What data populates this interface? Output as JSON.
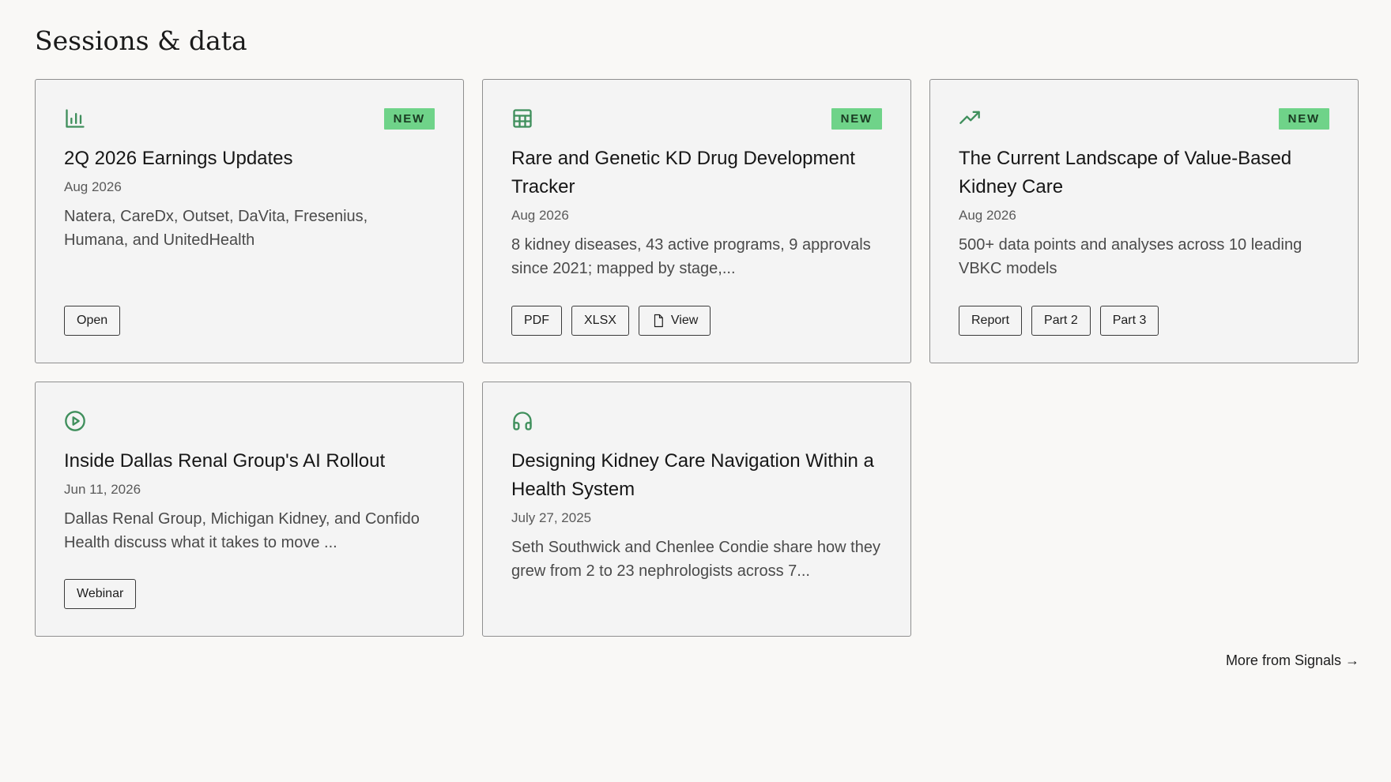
{
  "section": {
    "title": "Sessions & data"
  },
  "cards": [
    {
      "icon": "bar-chart-icon",
      "badge": "NEW",
      "title": "2Q 2026 Earnings Updates",
      "date": "Aug 2026",
      "description": "Natera, CareDx, Outset, DaVita, Fresenius, Humana, and UnitedHealth",
      "actions": [
        "Open"
      ]
    },
    {
      "icon": "table-icon",
      "badge": "NEW",
      "title": "Rare and Genetic KD Drug Development Tracker",
      "date": "Aug 2026",
      "description": "8 kidney diseases, 43 active programs, 9 approvals since 2021; mapped by stage,...",
      "actions": [
        "PDF",
        "XLSX",
        "View"
      ]
    },
    {
      "icon": "trending-up-icon",
      "badge": "NEW",
      "title": "The Current Landscape of Value-Based Kidney Care",
      "date": "Aug 2026",
      "description": "500+ data points and analyses across 10 leading VBKC models",
      "actions": [
        "Report",
        "Part 2",
        "Part 3"
      ]
    },
    {
      "icon": "play-circle-icon",
      "title": "Inside Dallas Renal Group's AI Rollout",
      "date": "Jun 11, 2026",
      "description": "Dallas Renal Group, Michigan Kidney, and Confido Health discuss what it takes to move ...",
      "actions": [
        "Webinar"
      ]
    },
    {
      "icon": "headphones-icon",
      "title": "Designing Kidney Care Navigation Within a Health System",
      "date": "July 27, 2025",
      "description": "Seth Southwick and Chenlee Condie share how they grew from 2 to 23 nephrologists across 7..."
    }
  ],
  "footer": {
    "more_link": "More from Signals →"
  },
  "colors": {
    "accent": "#3f8f5c",
    "badge_bg": "#6fd389",
    "card_bg": "#f4f4f4",
    "page_bg": "#f9f8f6"
  }
}
